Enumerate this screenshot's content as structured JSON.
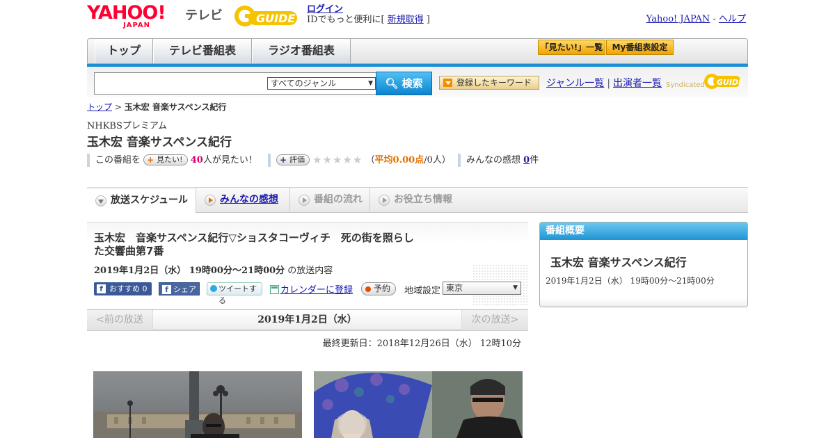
{
  "header": {
    "logo_yahoo": "YAHOO!",
    "logo_japan": "JAPAN",
    "logo_tv": "テレビ",
    "logo_gguide": "GUIDE",
    "login": "ログイン",
    "login_sub_prefix": "IDでもっと便利に[ ",
    "register": "新規取得",
    "login_sub_suffix": " ]",
    "yahoo_japan_link": "Yahoo! JAPAN",
    "sep": " - ",
    "help_link": "ヘルプ"
  },
  "nav": {
    "tabs": [
      "トップ",
      "テレビ番組表",
      "ラジオ番組表"
    ],
    "btn_mitai": "「見たい!」一覧",
    "btn_my": "My番組表設定"
  },
  "search": {
    "genre_selected": "すべてのジャンル",
    "button": "検索",
    "keyword_btn": "登録したキーワード",
    "genre_link": "ジャンル一覧",
    "link_sep": "|",
    "performer_link": "出演者一覧",
    "syndicated": "Syndicated"
  },
  "breadcrumb": {
    "top": "トップ",
    "sep": " > ",
    "current": "玉木宏 音楽サスペンス紀行"
  },
  "program": {
    "channel": "NHKBSプレミアム",
    "title": "玉木宏 音楽サスペンス紀行",
    "want_prefix": "この番組を",
    "want_btn": "見たい!",
    "want_count": "40",
    "want_suffix": "人が見たい！",
    "rate_btn": "評価",
    "stars": "★★★★★",
    "avg_open": "（",
    "avg_label": "平均0.00点",
    "avg_suffix": "/0人）",
    "impressions_label": "みんなの感想 ",
    "impressions_count": "0",
    "impressions_unit": "件"
  },
  "content_tabs": [
    "放送スケジュール",
    "みんなの感想",
    "番組の流れ",
    "お役立ち情報"
  ],
  "broadcast": {
    "title": "玉木宏　音楽サスペンス紀行▽ショスタコーヴィチ　死の街を照らした交響曲第7番",
    "date_time": "2019年1月2日（水） 19時00分～21時00分",
    "date_suffix": " の放送内容",
    "fb_recommend": "おすすめ 0",
    "fb_share": "シェア",
    "tweet": "ツイートする",
    "calendar": "カレンダーに登録",
    "reserve": "予約",
    "region_label": "地域設定",
    "region_value": "東京",
    "prev": "<前の放送",
    "date_nav": "2019年1月2日（水）",
    "next": "次の放送>",
    "updated": "最終更新日：2018年12月26日（水） 12時10分"
  },
  "side": {
    "header": "番組概要",
    "title": "玉木宏 音楽サスペンス紀行",
    "date": "2019年1月2日（水） 19時00分～21時00分"
  },
  "colors": {
    "accent_blue": "#1a8fd6",
    "yahoo_red": "#ff0033",
    "orange": "#f2a200"
  }
}
